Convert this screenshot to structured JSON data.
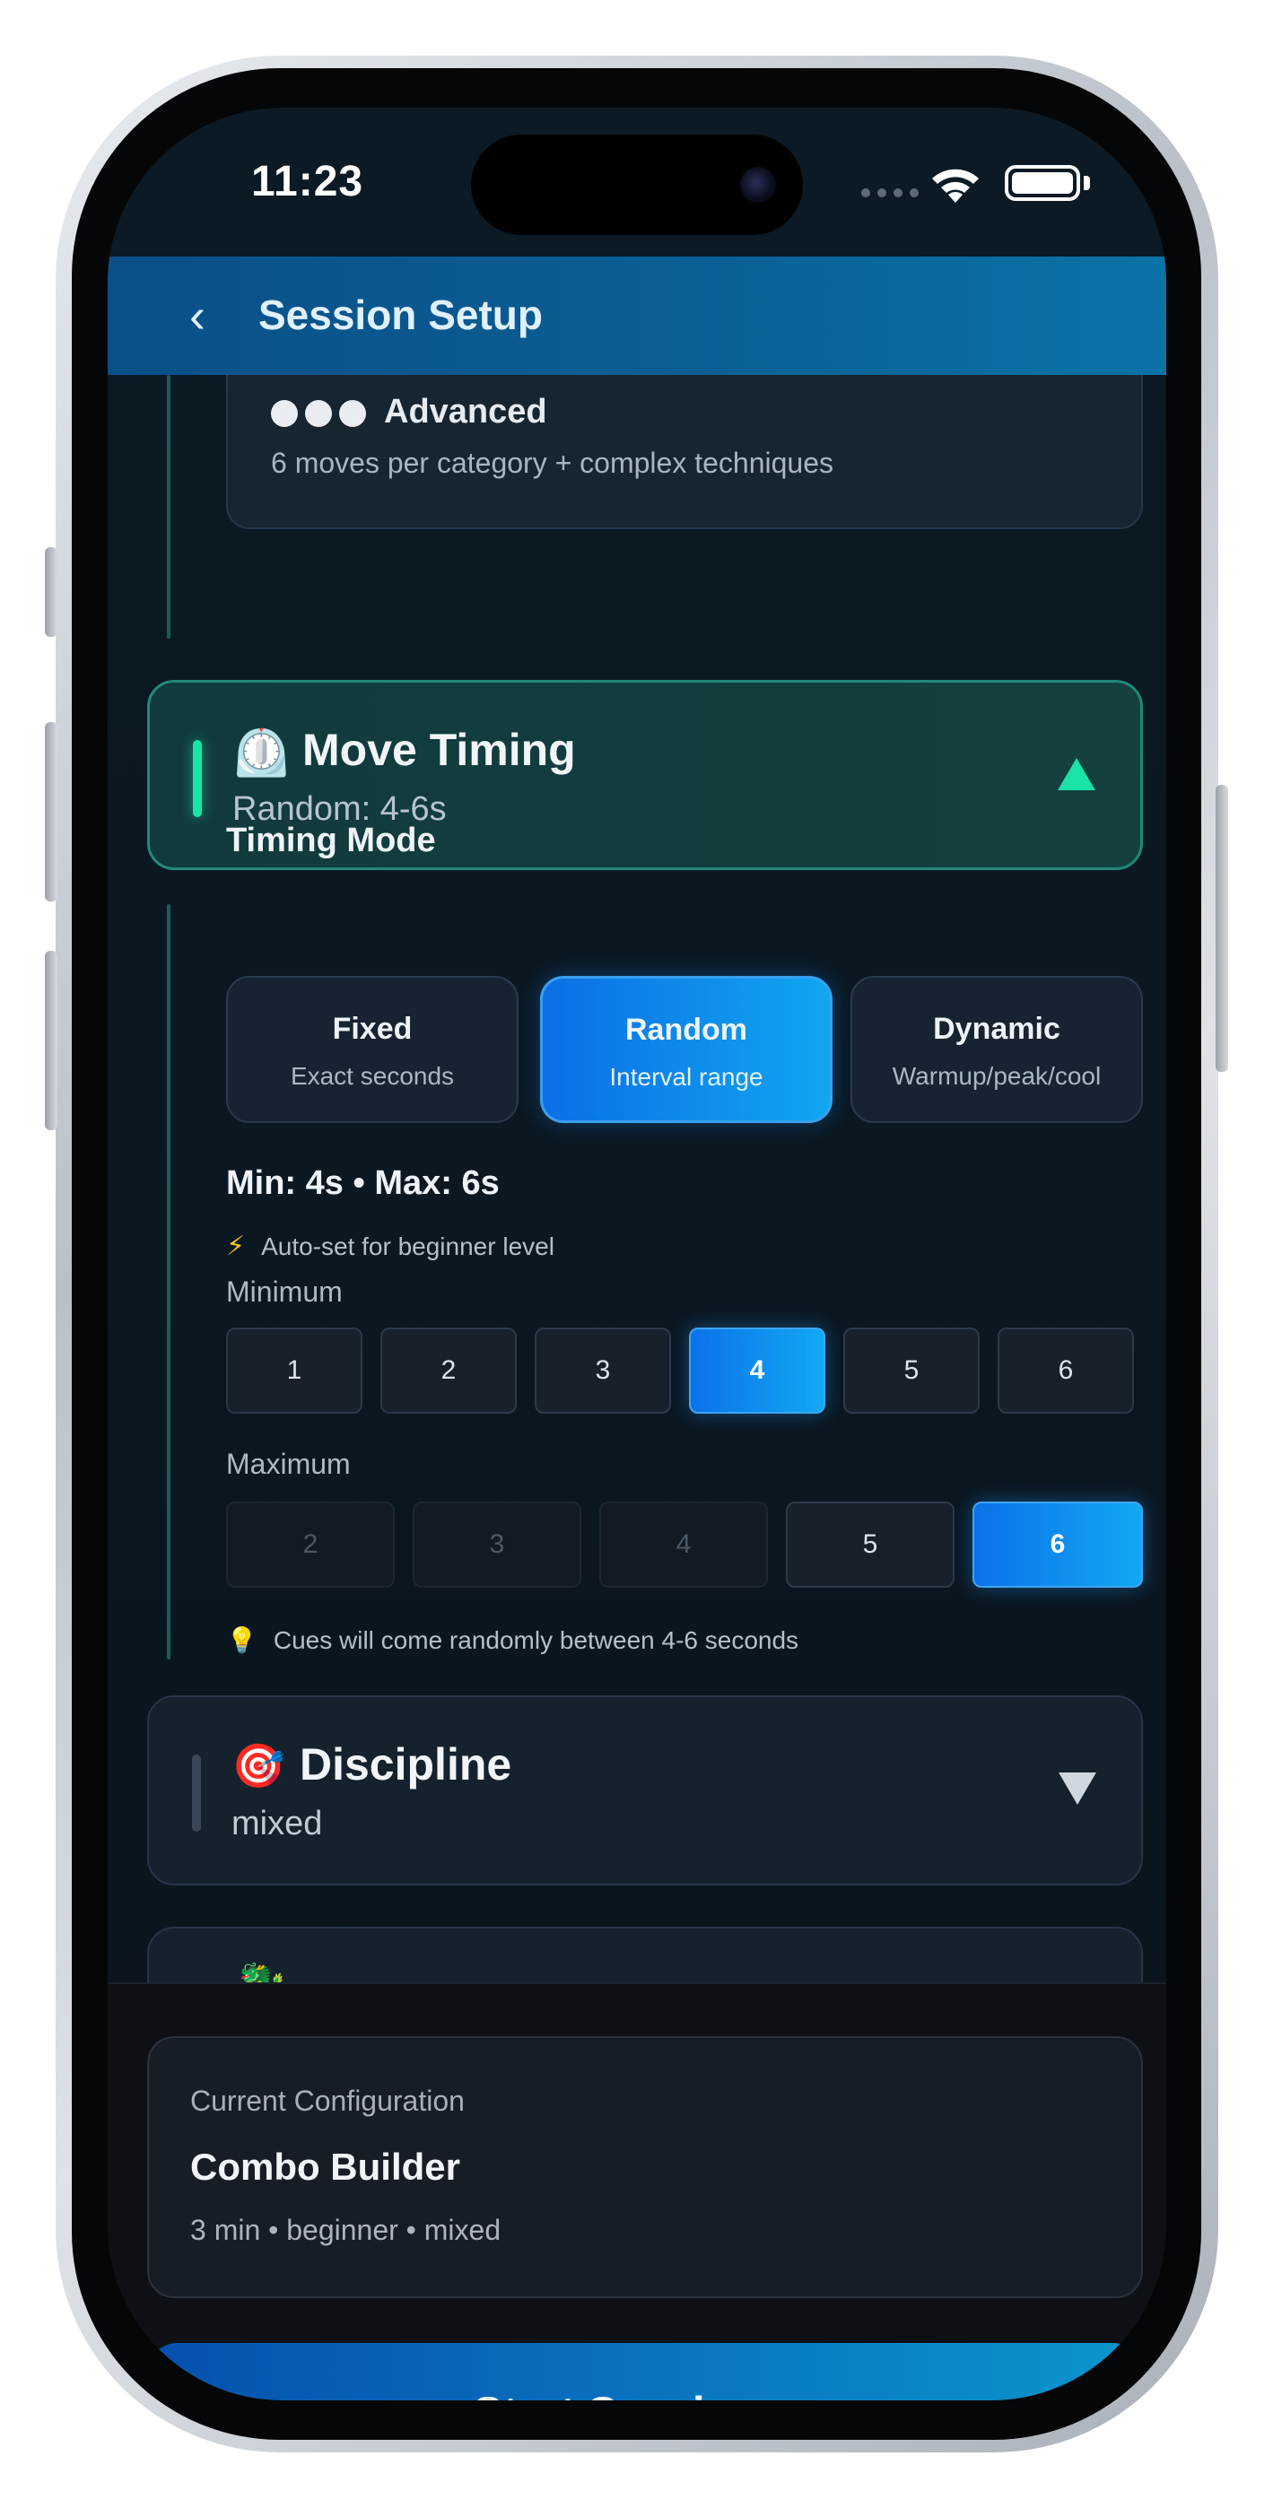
{
  "status_bar": {
    "time": "11:23"
  },
  "header": {
    "back_icon": "‹",
    "title": "Session Setup"
  },
  "difficulty_option": {
    "icon": "three-dots-icon",
    "label": "Advanced",
    "description": "6 moves per category + complex techniques"
  },
  "move_timing": {
    "icon": "⏲️",
    "title": "Move Timing",
    "summary": "Random: 4-6s",
    "expanded": true,
    "accent": "#17e6a4",
    "timing_mode_label": "Timing Mode",
    "modes": [
      {
        "title": "Fixed",
        "subtitle": "Exact seconds",
        "selected": false
      },
      {
        "title": "Random",
        "subtitle": "Interval range",
        "selected": true
      },
      {
        "title": "Dynamic",
        "subtitle": "Warmup/peak/cool",
        "selected": false
      }
    ],
    "range_label": "Min: 4s • Max: 6s",
    "auto_note_icon": "⚡",
    "auto_note": "Auto-set for beginner level",
    "minimum_label": "Minimum",
    "minimum_options": [
      "1",
      "2",
      "3",
      "4",
      "5",
      "6"
    ],
    "minimum_selected": "4",
    "maximum_label": "Maximum",
    "maximum_options": [
      "2",
      "3",
      "4",
      "5",
      "6"
    ],
    "maximum_disabled": [
      "2",
      "3",
      "4"
    ],
    "maximum_selected": "6",
    "cue_note_icon": "💡",
    "cue_note": "Cues will come randomly between 4-6 seconds"
  },
  "discipline": {
    "icon": "🎯",
    "title": "Discipline",
    "summary": "mixed",
    "expanded": false
  },
  "next_section": {
    "icon": "🐉"
  },
  "current_config": {
    "label": "Current Configuration",
    "name": "Combo Builder",
    "meta": "3 min • beginner • mixed"
  },
  "start_button": {
    "label": "Start Session →"
  },
  "colors": {
    "header": "#0a5f95",
    "accent_green": "#17e6a4",
    "selected_blue": "#0b8ff0",
    "background": "#0b1822"
  }
}
